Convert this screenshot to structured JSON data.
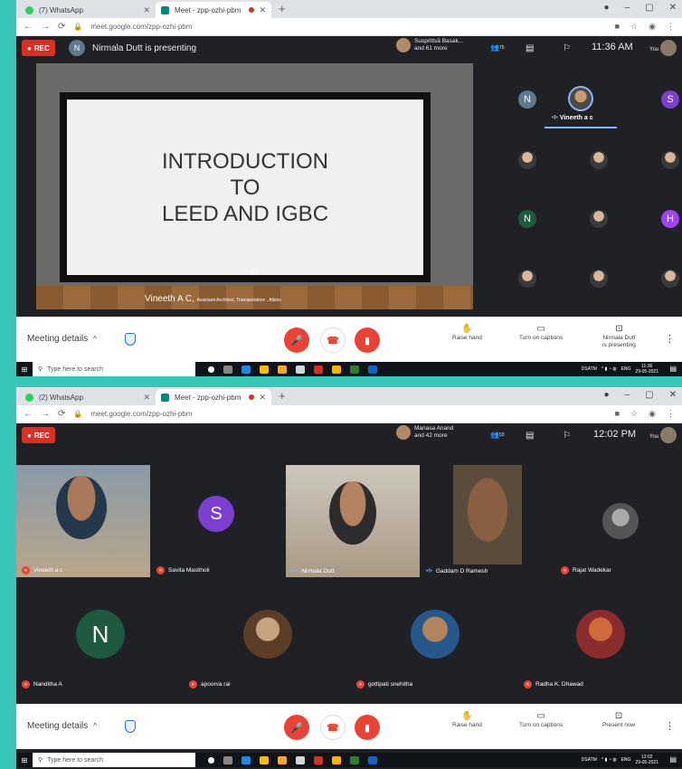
{
  "colors": {
    "teal_bg": "#37c7b6",
    "meet_bg": "#202124",
    "rec_red": "#d93025",
    "accent_blue": "#8ab4f8"
  },
  "screenshots": [
    {
      "tabs": [
        {
          "title": "(7) WhatsApp"
        },
        {
          "title": "Meet - zpp-ozhi-pbm"
        }
      ],
      "url": "meet.google.com/zpp-ozhi-pbm",
      "rec_label": "REC",
      "presenter_initial": "N",
      "presenter_text": "Nirmala Dutt is presenting",
      "speaker_name": "Susprittsā Basak...",
      "speaker_more": "and 61 more",
      "participant_count": "75",
      "clock": "11:36 AM",
      "you_label": "You",
      "slide": {
        "title_line1": "INTRODUCTION",
        "title_line2": "TO",
        "title_line3": "LEED AND IGBC",
        "by": "By",
        "author": "Vineeth A C,",
        "author_role": "Assistant Architect, Transportation , Atkins"
      },
      "tiles": [
        {
          "initial": "N",
          "color": "#5f7a8c"
        },
        {
          "initial": "S",
          "color": "#7b3fd1"
        },
        {
          "initial": "N",
          "color": "#1e5a40"
        },
        {
          "initial": "H",
          "color": "#a142f4"
        }
      ],
      "active_speaker": "Vineeth a c",
      "bottom": {
        "meeting_details": "Meeting details",
        "raise_hand": "Raise hand",
        "captions": "Turn on captions",
        "present_line1": "Nirmala Dutt",
        "present_line2": "is presenting"
      },
      "taskbar": {
        "search_placeholder": "Type here to search",
        "tray_label": "DSATM",
        "lang": "ENG",
        "time": "11:36",
        "date": "29-05-2021"
      }
    },
    {
      "tabs": [
        {
          "title": "(2) WhatsApp"
        },
        {
          "title": "Meet - zpp-ozhi-pbm"
        }
      ],
      "url": "meet.google.com/zpp-ozhi-pbm",
      "rec_label": "REC",
      "speaker_name": "Manasa Anand",
      "speaker_more": "and 42 more",
      "participant_count": "53",
      "clock": "12:02 PM",
      "you_label": "You",
      "participants": [
        {
          "name": "Vineeth a c"
        },
        {
          "name": "Savita Mastiholi",
          "initial": "S",
          "color": "#7b3fd1"
        },
        {
          "name": "Nirmala Dutt"
        },
        {
          "name": "Gaddam D Ramesh"
        },
        {
          "name": "Rajat Wadekar"
        },
        {
          "name": "Nanditha A",
          "initial": "N",
          "color": "#1e5a40"
        },
        {
          "name": "apoorva rai"
        },
        {
          "name": "gottipati snehitha"
        },
        {
          "name": "Radha K. Dhawad"
        }
      ],
      "bottom": {
        "meeting_details": "Meeting details",
        "raise_hand": "Raise hand",
        "captions": "Turn on captions",
        "present_now": "Present now"
      },
      "taskbar": {
        "search_placeholder": "Type here to search",
        "tray_label": "DSATM",
        "lang": "ENG",
        "time": "12:02",
        "date": "29-05-2021"
      }
    }
  ]
}
